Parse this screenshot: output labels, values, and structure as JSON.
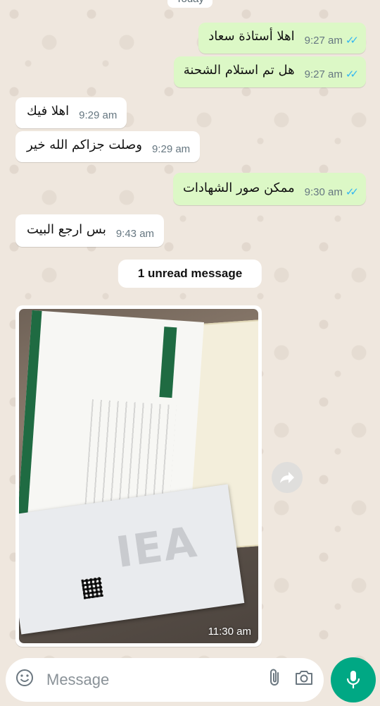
{
  "header": {
    "date_chip": "Today"
  },
  "messages": [
    {
      "dir": "out",
      "text": "اهلا أستاذة سعاد",
      "time": "9:27 am"
    },
    {
      "dir": "out",
      "text": "هل تم استلام الشحنة",
      "time": "9:27 am"
    },
    {
      "dir": "in",
      "text": "اهلا فيك",
      "time": "9:29 am"
    },
    {
      "dir": "in",
      "text": "وصلت جزاكم الله خير",
      "time": "9:29 am"
    },
    {
      "dir": "out",
      "text": "ممكن صور الشهادات",
      "time": "9:30 am"
    },
    {
      "dir": "in",
      "text": "بس ارجع البيت",
      "time": "9:43 am"
    }
  ],
  "unread_banner": "1 unread message",
  "photo_message": {
    "time": "11:30 am"
  },
  "composer": {
    "placeholder": "Message"
  },
  "colors": {
    "outgoing_bubble": "#dcf8c6",
    "incoming_bubble": "#ffffff",
    "read_ticks": "#34b7f1",
    "mic_button": "#00a884",
    "wallpaper": "#efe7de"
  },
  "icons": {
    "read_ticks": "double-check-icon",
    "forward": "forward-icon",
    "emoji": "emoji-icon",
    "attach": "paperclip-icon",
    "camera": "camera-icon",
    "mic": "microphone-icon"
  }
}
